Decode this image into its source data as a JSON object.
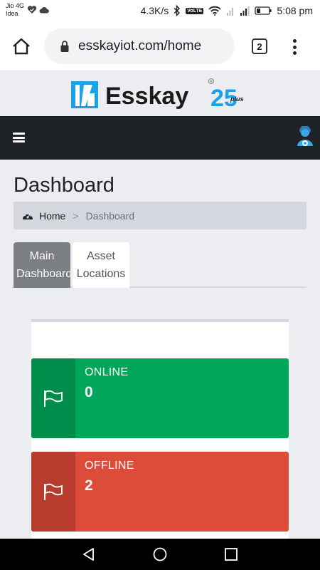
{
  "status_bar": {
    "carrier_line1": "Jio 4G",
    "carrier_line2": "Idea",
    "speed": "4.3K/s",
    "volte": "VoLTE",
    "time": "5:08 pm"
  },
  "browser": {
    "url": "esskayiot.com/home",
    "tab_count": "2"
  },
  "navbar": {
    "bg_color": "#1f2328"
  },
  "page": {
    "title": "Dashboard"
  },
  "breadcrumb": {
    "home": "Home",
    "separator": ">",
    "current": "Dashboard"
  },
  "tabs": [
    {
      "line1": "Main",
      "line2": "Dashboard"
    },
    {
      "line1": "Asset",
      "line2": "Locations"
    }
  ],
  "cards": {
    "online": {
      "label": "ONLINE",
      "value": "0",
      "color": "#00a65a"
    },
    "offline": {
      "label": "OFFLINE",
      "value": "2",
      "color": "#dd4b39"
    }
  }
}
